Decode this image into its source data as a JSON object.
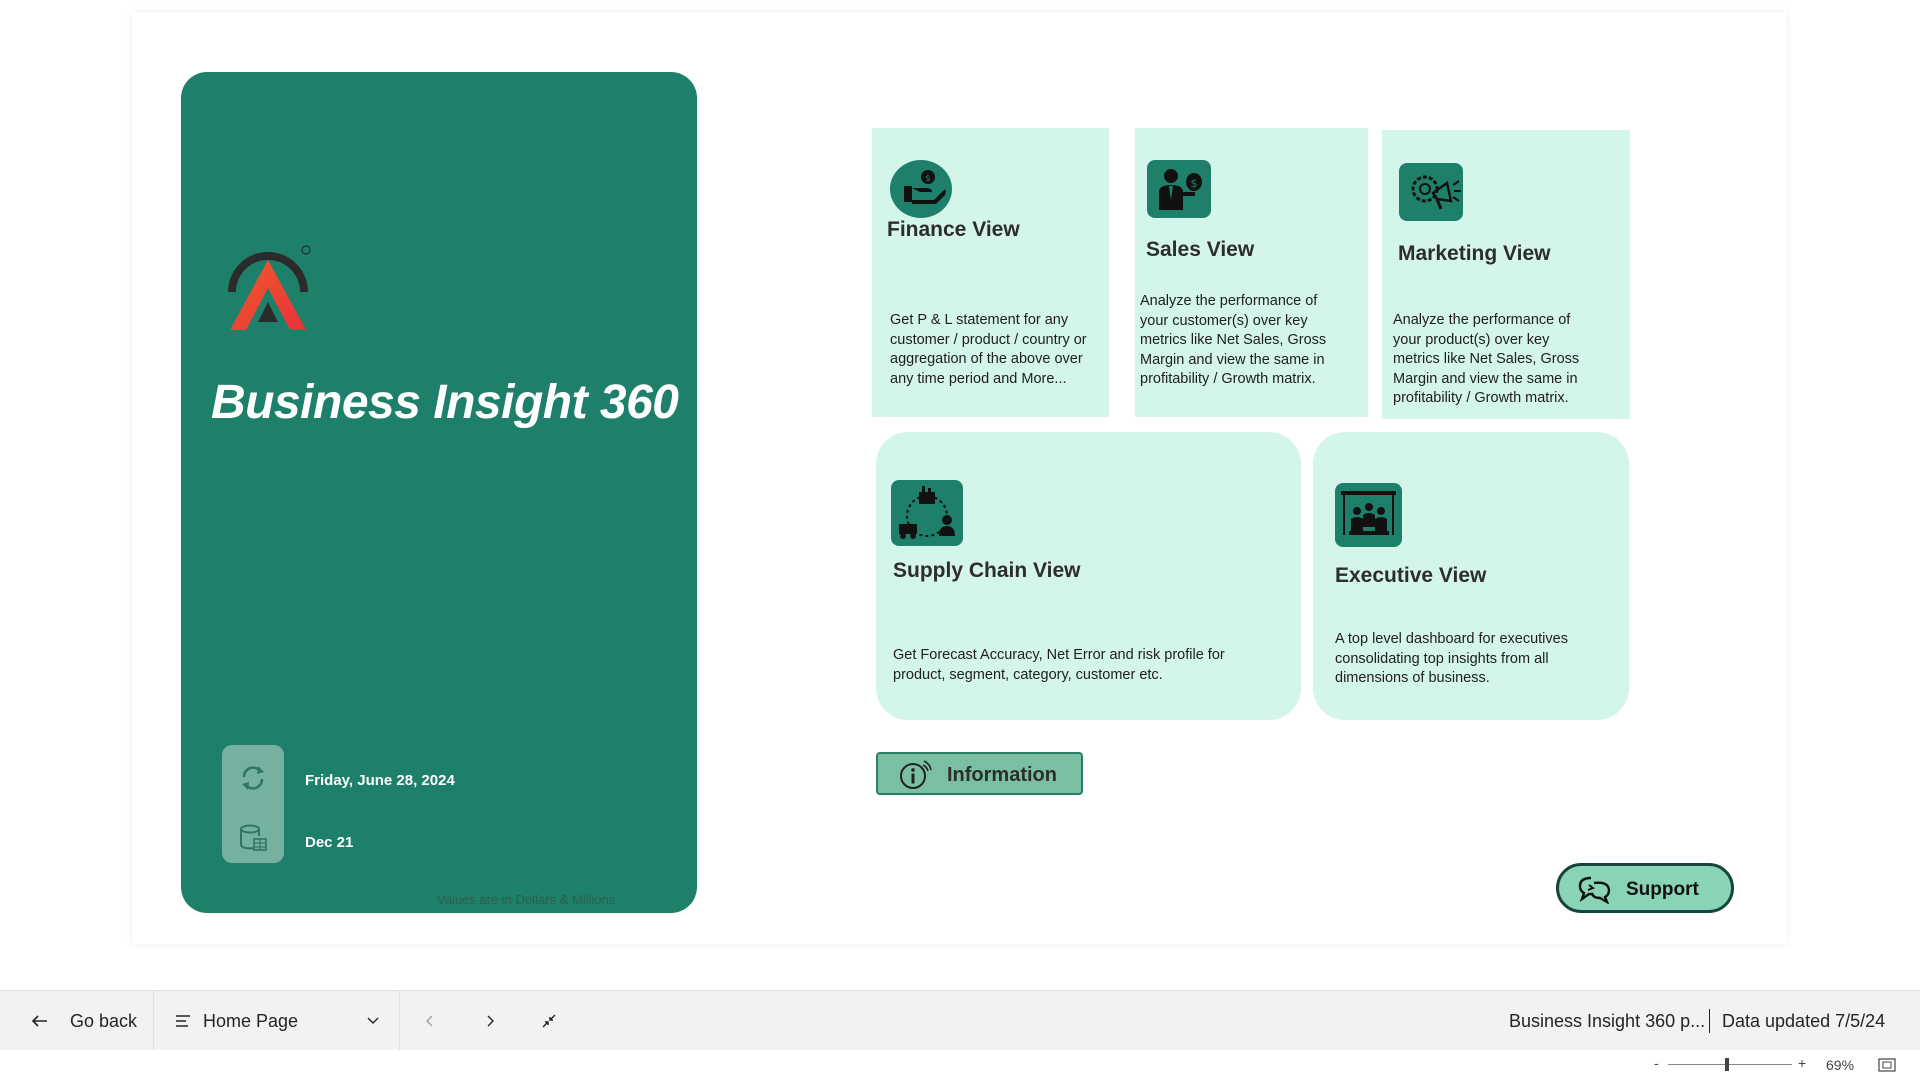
{
  "hero": {
    "title": "Business Insight 360",
    "refresh_date": "Friday, June 28, 2024",
    "period": "Dec 21",
    "footnote": "Values are in Dollars & Millions"
  },
  "cards": {
    "finance": {
      "title": "Finance View",
      "desc": "Get P & L statement for any customer / product / country or aggregation of the above over any time period and More..."
    },
    "sales": {
      "title": "Sales View",
      "desc": "Analyze the performance of your customer(s) over key metrics like Net Sales, Gross Margin and view the same in profitability / Growth matrix."
    },
    "marketing": {
      "title": "Marketing View",
      "desc": "Analyze the performance of your product(s) over key metrics like Net Sales, Gross Margin and view the same in profitability / Growth matrix."
    },
    "supply": {
      "title": "Supply Chain View",
      "desc": "Get Forecast Accuracy, Net Error and risk profile for product, segment, category, customer etc."
    },
    "executive": {
      "title": "Executive View",
      "desc": "A top level dashboard for executives consolidating top insights from all dimensions of business."
    }
  },
  "buttons": {
    "information": "Information",
    "support": "Support"
  },
  "bottom_bar": {
    "go_back": "Go back",
    "page_select": "Home Page",
    "report_name": "Business Insight 360 p...",
    "data_updated": "Data updated 7/5/24",
    "zoom_minus": "-",
    "zoom_plus": "+",
    "zoom_level": "69%",
    "zoom_fraction": 0.69
  },
  "colors": {
    "brand": "#1e806b",
    "card_bg": "#d4f5ea",
    "info_button": "#7bbfa3",
    "support_button": "#89d3b6"
  },
  "icons": {
    "finance": "money-hand-icon",
    "sales": "salesperson-dollar-icon",
    "marketing": "megaphone-gear-icon",
    "supply": "supply-chain-cycle-icon",
    "executive": "meeting-board-icon",
    "information": "info-circle-icon",
    "support": "chat-support-icon"
  }
}
